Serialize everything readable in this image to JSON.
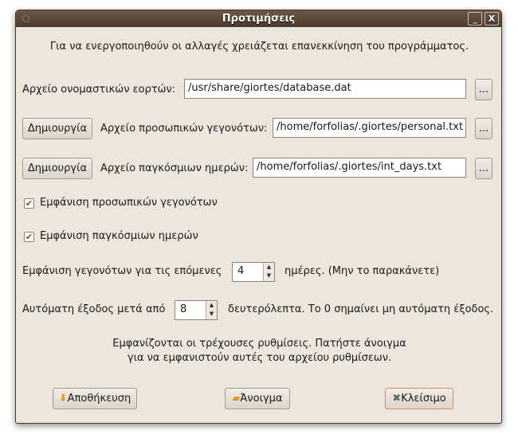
{
  "window": {
    "title": "Προτιμήσεις",
    "minimize": "_",
    "close": "X"
  },
  "notice": "Για να ενεργοποιηθούν οι αλλαγές χρειάζεται επανεκκίνηση του προγράμματος.",
  "namedays": {
    "label": "Αρχείο ονομαστικών εορτών:",
    "value": "/usr/share/giortes/database.dat",
    "browse": "..."
  },
  "personal": {
    "create": "Δημιουργία",
    "label": "Αρχείο προσωπικών γεγονότων:",
    "value": "/home/forfolias/.giortes/personal.txt",
    "browse": "..."
  },
  "intdays": {
    "create": "Δημιουργία",
    "label": "Αρχείο παγκόσμιων ημερών:",
    "value": "/home/forfolias/.giortes/int_days.txt",
    "browse": "..."
  },
  "show_personal": {
    "label": "Εμφάνιση προσωπικών γεγονότων",
    "checked": true
  },
  "show_intdays": {
    "label": "Εμφάνιση παγκόσμιων ημερών",
    "checked": true
  },
  "days_ahead": {
    "label": "Εμφάνιση γεγονότων για τις επόμενες",
    "value": "4",
    "suffix": "ημέρες. (Μην το παρακάνετε)"
  },
  "auto_exit": {
    "label": "Αυτόματη έξοδος μετά από",
    "value": "8",
    "suffix": "δευτερόλεπτα. Το 0 σημαίνει μη αυτόματη έξοδος."
  },
  "info": [
    "Εμφανίζονται οι τρέχουσες ρυθμίσεις. Πατήστε άνοιγμα",
    "για να εμφανιστούν αυτές του αρχείου ρυθμίσεων."
  ],
  "buttons": {
    "save": "Αποθήκευση",
    "open": "Άνοιγμα",
    "close": "Κλείσιμο"
  }
}
